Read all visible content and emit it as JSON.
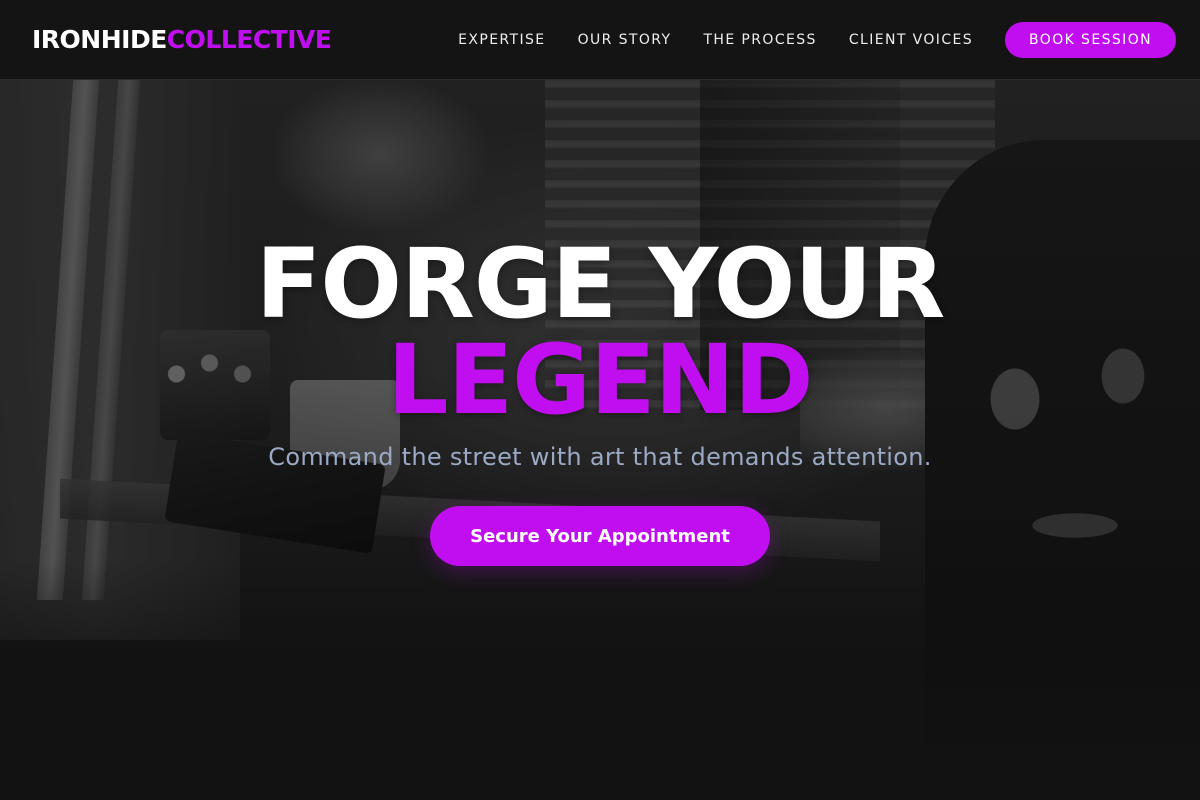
{
  "brand": {
    "part1": "IRONHIDE",
    "part2": "COLLECTIVE",
    "accent_color": "#c10ef0"
  },
  "nav": {
    "items": [
      {
        "label": "EXPERTISE"
      },
      {
        "label": "OUR STORY"
      },
      {
        "label": "THE PROCESS"
      },
      {
        "label": "CLIENT VOICES"
      }
    ],
    "book_label": "BOOK SESSION"
  },
  "hero": {
    "headline_line1": "FORGE YOUR",
    "headline_line2": "LEGEND",
    "subtitle": "Command the street with art that demands attention.",
    "cta_label": "Secure Your Appointment",
    "background_image": "tattoo-studio-photo"
  },
  "colors": {
    "header_bg": "#141414",
    "headline_primary": "#ffffff",
    "subtitle": "#9aa9c4"
  }
}
